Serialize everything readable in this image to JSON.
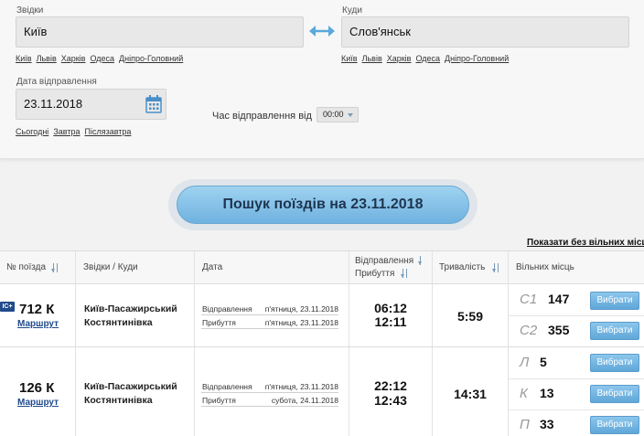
{
  "form": {
    "from_label": "Звідки",
    "from_value": "Київ",
    "to_label": "Куди",
    "to_value": "Слов'янськ",
    "from_quick": [
      "Київ",
      "Львів",
      "Харків",
      "Одеса",
      "Дніпро-Головний"
    ],
    "to_quick": [
      "Київ",
      "Львів",
      "Харків",
      "Одеса",
      "Дніпро-Головний"
    ],
    "date_label": "Дата відправлення",
    "date_value": "23.11.2018",
    "date_quick": [
      "Сьогодні",
      "Завтра",
      "Післязавтра"
    ],
    "time_label": "Час відправлення від",
    "time_value": "00:00"
  },
  "search_button": "Пошук поїздів на 23.11.2018",
  "show_all_link": "Показати без вільних місць",
  "table": {
    "headers": {
      "train": "№ поїзда",
      "route": "Звідки / Куди",
      "date": "Дата",
      "dep": "Відправлення",
      "arr": "Прибуття",
      "duration": "Тривалість",
      "seats": "Вільних місць"
    },
    "rows": [
      {
        "badge": "IC+",
        "number": "712 К",
        "route_link": "Маршрут",
        "from": "Київ-Пасажирський",
        "to": "Костянтинівка",
        "dep_label": "Відправлення",
        "dep_date": "п'ятниця, 23.11.2018",
        "arr_label": "Прибуття",
        "arr_date": "п'ятниця, 23.11.2018",
        "dep_time": "06:12",
        "arr_time": "12:11",
        "duration": "5:59",
        "seats": [
          {
            "cls": "С1",
            "count": "147",
            "button": "Вибрати"
          },
          {
            "cls": "С2",
            "count": "355",
            "button": "Вибрати"
          }
        ]
      },
      {
        "number": "126 К",
        "route_link": "Маршрут",
        "from": "Київ-Пасажирський",
        "to": "Костянтинівка",
        "dep_label": "Відправлення",
        "dep_date": "п'ятниця, 23.11.2018",
        "arr_label": "Прибуття",
        "arr_date": "субота, 24.11.2018",
        "dep_time": "22:12",
        "arr_time": "12:43",
        "duration": "14:31",
        "seats": [
          {
            "cls": "Л",
            "count": "5",
            "button": "Вибрати"
          },
          {
            "cls": "К",
            "count": "13",
            "button": "Вибрати"
          },
          {
            "cls": "П",
            "count": "33",
            "button": "Вибрати"
          }
        ]
      }
    ]
  },
  "colors": {
    "accent_blue": "#6fb2e0",
    "link_blue": "#1f4a8c",
    "calendar_icon": "#4a8fc8"
  },
  "icons": [
    "swap-arrows-icon",
    "calendar-icon",
    "sort-icon",
    "caret-down-icon",
    "intercity-badge-icon"
  ]
}
